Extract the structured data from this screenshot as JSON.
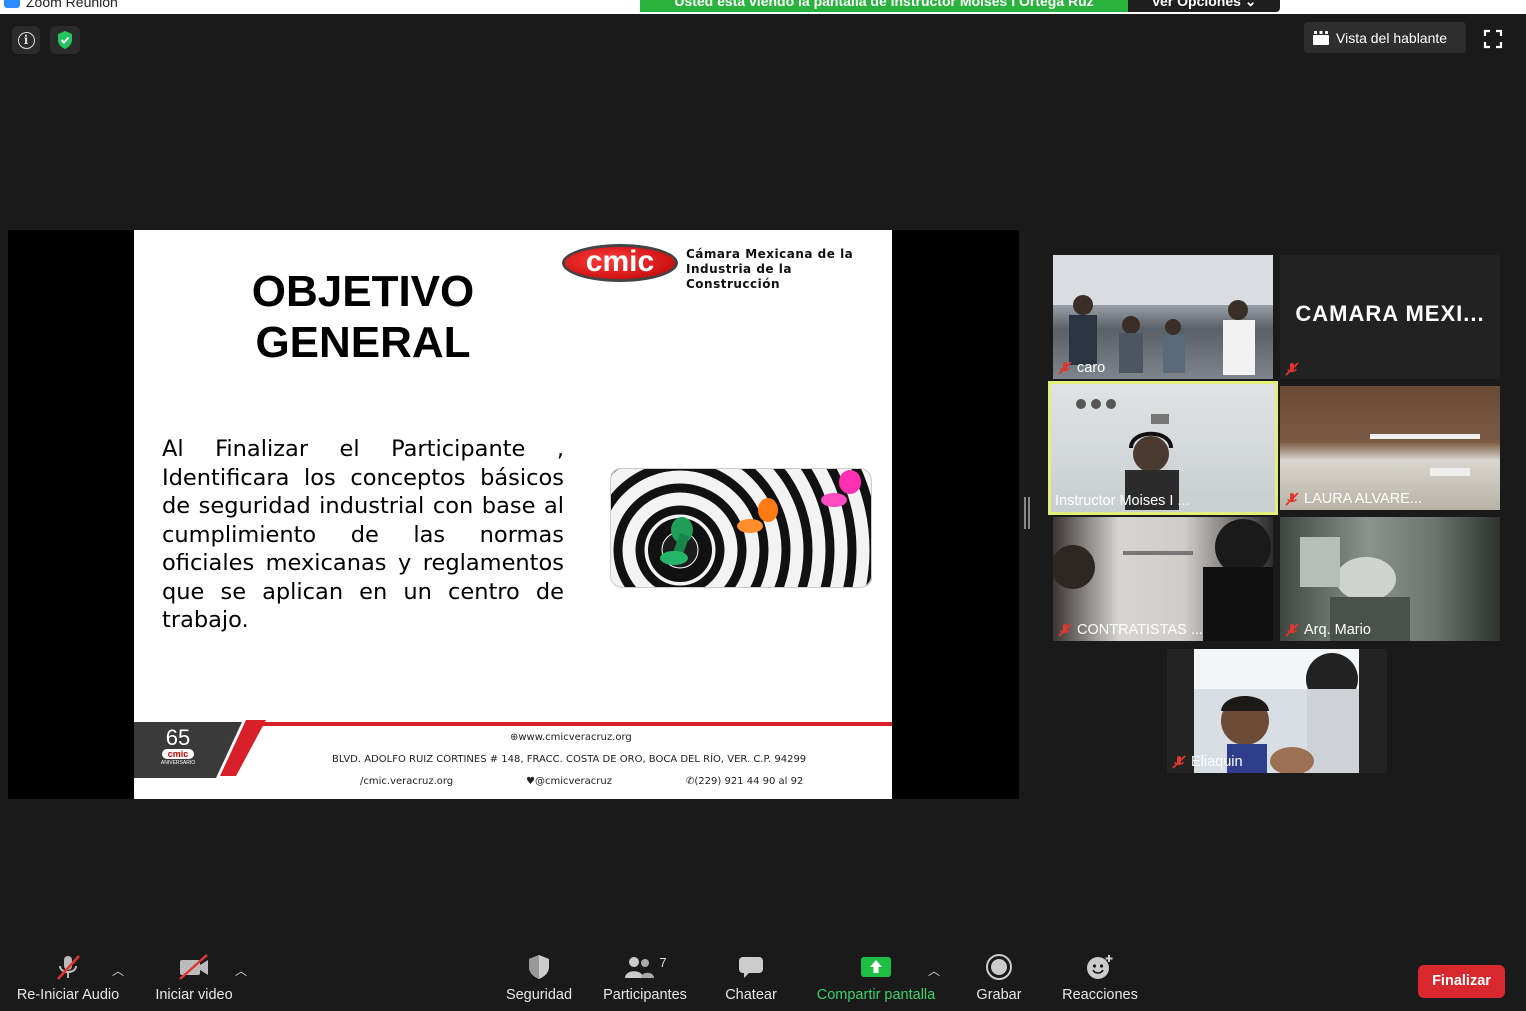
{
  "window": {
    "title": "Zoom Reunión",
    "share_banner": "Usted está viendo la pantalla de Instructor Moises I Ortega Ruz",
    "view_options": "Ver Opciones ⌄"
  },
  "header": {
    "speaker_view_label": "Vista del hablante"
  },
  "slide": {
    "title_line1": "OBJETIVO",
    "title_line2": "GENERAL",
    "body": "Al Finalizar el Participante , Identificara los conceptos básicos de seguridad industrial con base al cumplimiento de las normas oficiales mexicanas y reglamentos que se aplican en un centro de trabajo.",
    "logo_word": "cmic",
    "logo_name_line1": "Cámara Mexicana de la",
    "logo_name_line2": "Industria de la Construcción",
    "anniversary_number": "65",
    "anniversary_logo": "cmic",
    "anniversary_label": "ANIVERSARIO",
    "footer_web": "⊕www.cmicveracruz.org",
    "footer_address": "BLVD. ADOLFO RUIZ CORTINES # 148, FRACC. COSTA DE ORO, BOCA DEL RÍO, VER. C.P. 94299",
    "footer_facebook": "/cmic.veracruz.org",
    "footer_twitter": "@cmicveracruz",
    "footer_phone": "(229) 921 44 90 al 92"
  },
  "participants": [
    {
      "name": "caro",
      "muted": true
    },
    {
      "name": "CAMARA  MEXI...",
      "muted": true
    },
    {
      "name": "Instructor Moises I ...",
      "muted": false,
      "active_speaker": true
    },
    {
      "name": "LAURA ALVARE...",
      "muted": true
    },
    {
      "name": "CONTRATISTAS ...",
      "muted": true
    },
    {
      "name": "Arq. Mario",
      "muted": true
    },
    {
      "name": "Eliaquin",
      "muted": true
    }
  ],
  "toolbar": {
    "audio_label": "Re-Iniciar Audio",
    "video_label": "Iniciar video",
    "security_label": "Seguridad",
    "participants_label": "Participantes",
    "participants_count": "7",
    "chat_label": "Chatear",
    "share_label": "Compartir pantalla",
    "record_label": "Grabar",
    "reactions_label": "Reacciones",
    "end_label": "Finalizar"
  },
  "colors": {
    "background": "#1a1a1a",
    "share_green": "#29b33d",
    "end_red": "#d9282d",
    "active_speaker_border": "#e4ef7a",
    "mute_red": "#e0362e"
  }
}
